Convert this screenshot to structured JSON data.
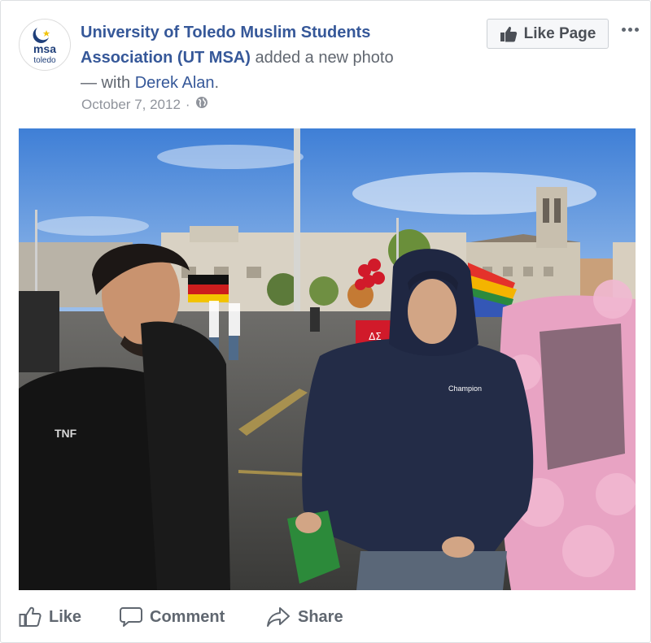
{
  "post": {
    "page_name": "University of Toledo Muslim Students Association (UT MSA)",
    "action_text": " added a new photo",
    "with_text": " — with ",
    "tagged_name": "Derek Alan",
    "tagged_suffix": ".",
    "date": "October 7, 2012",
    "separator": "·",
    "privacy_icon": "globe-icon"
  },
  "avatar": {
    "logo_text_top": "msa",
    "logo_text_bottom": "toledo"
  },
  "header_buttons": {
    "like_page_label": "Like Page",
    "more_icon": "ellipsis-icon"
  },
  "photo": {
    "banner_text": "ΔΣ",
    "hoodie_brand": "Champion",
    "jacket_brand": "TNF"
  },
  "actions": {
    "like_label": "Like",
    "comment_label": "Comment",
    "share_label": "Share"
  },
  "colors": {
    "link": "#365899",
    "secondary": "#90949c",
    "action": "#606770"
  }
}
